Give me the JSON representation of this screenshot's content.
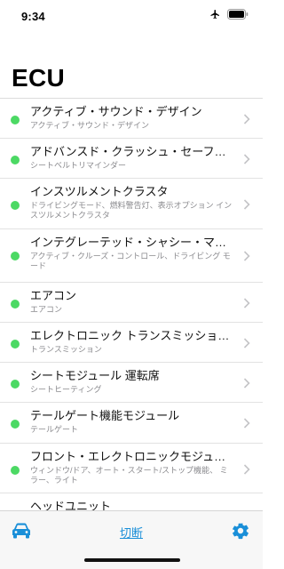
{
  "status_bar": {
    "time": "9:34"
  },
  "header": {
    "title": "ECU"
  },
  "colors": {
    "connected_dot": "#4cd964",
    "accent": "#1a8fd8"
  },
  "ecus": [
    {
      "title": "アクティブ・サウンド・デザイン",
      "subtitle": "アクティブ・サウンド・デザイン"
    },
    {
      "title": "アドバンスド・クラッシュ・セーフテ…",
      "subtitle": "シートベルトリマインダー"
    },
    {
      "title": "インスツルメントクラスタ",
      "subtitle": "ドライビングモード、燃料警告灯、表示オプション インスツルメントクラスタ"
    },
    {
      "title": "インテグレーテッド・シャシー・マネ…",
      "subtitle": "アクティブ・クルーズ・コントロール、ドライビング モード"
    },
    {
      "title": "エアコン",
      "subtitle": "エアコン"
    },
    {
      "title": "エレクトロニック トランスミッション…",
      "subtitle": "トランスミッション"
    },
    {
      "title": "シートモジュール 運転席",
      "subtitle": "シートヒーティング"
    },
    {
      "title": "テールゲート機能モジュール",
      "subtitle": "テールゲート"
    },
    {
      "title": "フロント・エレクトロニックモジュール",
      "subtitle": "ウィンドウ/ドア、オート・スタート/ストップ機能、 ミラー、ライト"
    },
    {
      "title": "ヘッドユニット",
      "subtitle": ""
    }
  ],
  "tab_bar": {
    "car_icon": "car-icon",
    "disconnect_label": "切断",
    "settings_icon": "gear-icon"
  }
}
